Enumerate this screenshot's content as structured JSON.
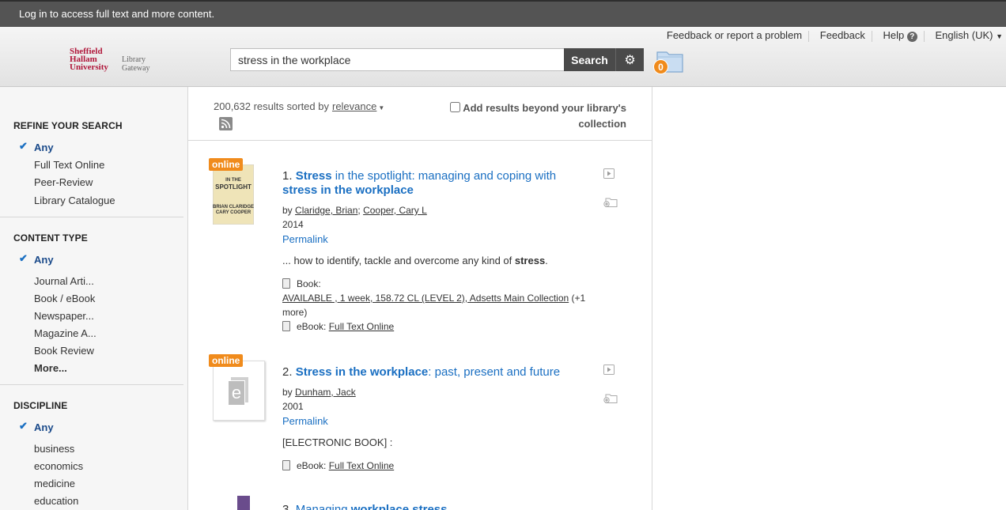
{
  "topbar": {
    "login_text": "Log in to access full text and more content."
  },
  "header": {
    "logo_university": "Sheffield Hallam University",
    "logo_library": "Library Gateway",
    "search_value": "stress in the workplace",
    "search_label": "Search",
    "gear_glyph": "⚙",
    "folder_count": "0",
    "links": {
      "feedback_problem": "Feedback or report a problem",
      "feedback": "Feedback",
      "help": "Help",
      "help_glyph": "?",
      "language": "English (UK)"
    }
  },
  "sidebar": {
    "refine": {
      "heading": "REFINE YOUR SEARCH",
      "selected": "Any",
      "items": [
        "Full Text Online",
        "Peer-Review",
        "Library Catalogue"
      ]
    },
    "content_type": {
      "heading": "CONTENT TYPE",
      "selected": "Any",
      "items": [
        "Journal Arti...",
        "Book / eBook",
        "Newspaper...",
        "Magazine A...",
        "Book Review"
      ],
      "more": "More..."
    },
    "discipline": {
      "heading": "DISCIPLINE",
      "selected": "Any",
      "items": [
        "business",
        "economics",
        "medicine",
        "education"
      ]
    }
  },
  "results_header": {
    "count_text": "200,632 results sorted by",
    "sort_label": "relevance",
    "beyond_label": "Add results beyond your library's collection"
  },
  "results": [
    {
      "number": "1.",
      "badge": "online",
      "title_parts": [
        "Stress",
        " in the spotlight: managing and coping with ",
        "stress in the workplace"
      ],
      "by": "by",
      "authors": [
        "Claridge, Brian",
        "Cooper, Cary L"
      ],
      "year": "2014",
      "permalink": "Permalink",
      "snippet_pre": "... how to identify, tackle and overcome any kind of ",
      "snippet_bold": "stress",
      "snippet_post": ".",
      "format1": "Book:",
      "availability": "AVAILABLE , 1 week, 158.72 CL (LEVEL 2), Adsetts Main Collection",
      "availability_more": "(+1 more)",
      "format2": "eBook:",
      "full_text": "Full Text Online",
      "cover_lines": [
        "STRESS",
        "IN THE",
        "SPOTLIGHT",
        "BRIAN CLARIDGE",
        "CARY COOPER"
      ]
    },
    {
      "number": "2.",
      "badge": "online",
      "title_parts": [
        "Stress in the workplace",
        ": past, present and future"
      ],
      "by": "by",
      "authors": [
        "Dunham, Jack"
      ],
      "year": "2001",
      "permalink": "Permalink",
      "snippet": "[ELECTRONIC BOOK] :",
      "format2": "eBook:",
      "full_text": "Full Text Online",
      "ebook_glyph": "e"
    },
    {
      "number": "3.",
      "title_parts": [
        "Managing ",
        "workplace stress"
      ]
    }
  ]
}
